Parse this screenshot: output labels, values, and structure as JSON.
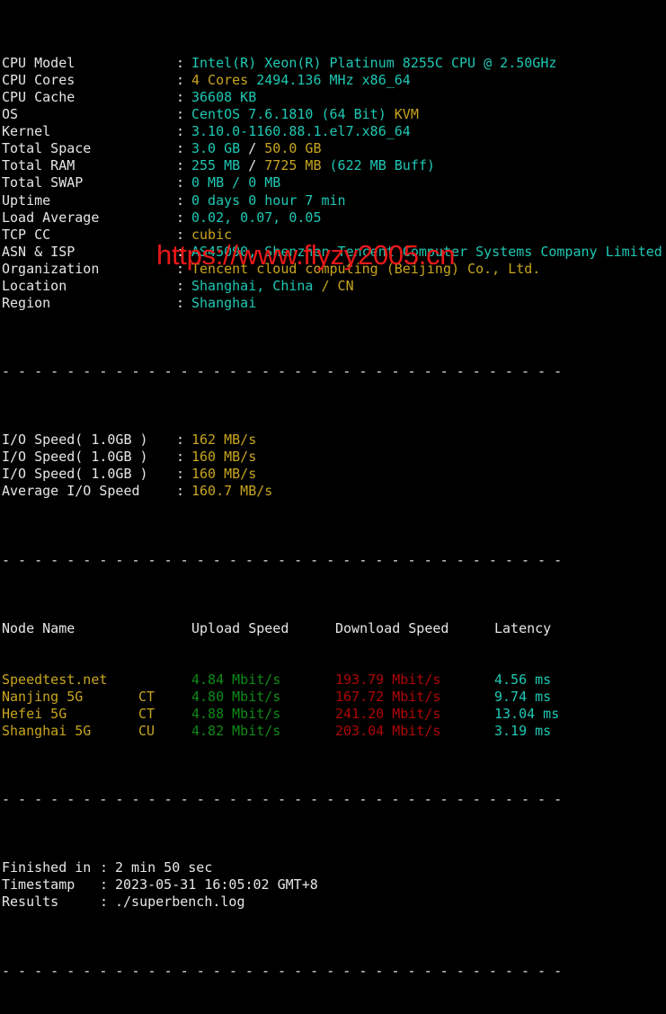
{
  "terminal": {
    "colon": ":",
    "separator_char": "-",
    "info_rows": [
      {
        "label": "CPU Model",
        "segments": [
          {
            "text": "Intel(R) Xeon(R) Platinum 8255C CPU @ 2.50GHz",
            "color": "cyan"
          }
        ]
      },
      {
        "label": "CPU Cores",
        "segments": [
          {
            "text": "4 Cores ",
            "color": "yellow"
          },
          {
            "text": "2494.136 MHz x86_64",
            "color": "cyan"
          }
        ]
      },
      {
        "label": "CPU Cache",
        "segments": [
          {
            "text": "36608 KB",
            "color": "cyan"
          }
        ]
      },
      {
        "label": "OS",
        "segments": [
          {
            "text": "CentOS 7.6.1810 (64 Bit) ",
            "color": "cyan"
          },
          {
            "text": "KVM",
            "color": "yellow"
          }
        ]
      },
      {
        "label": "Kernel",
        "segments": [
          {
            "text": "3.10.0-1160.88.1.el7.x86_64",
            "color": "cyan"
          }
        ]
      },
      {
        "label": "Total Space",
        "segments": [
          {
            "text": "3.0 GB ",
            "color": "cyan"
          },
          {
            "text": "/ ",
            "color": "white"
          },
          {
            "text": "50.0 GB",
            "color": "yellow"
          }
        ]
      },
      {
        "label": "Total RAM",
        "segments": [
          {
            "text": "255 MB ",
            "color": "cyan"
          },
          {
            "text": "/ ",
            "color": "white"
          },
          {
            "text": "7725 MB ",
            "color": "yellow"
          },
          {
            "text": "(622 MB Buff)",
            "color": "cyan"
          }
        ]
      },
      {
        "label": "Total SWAP",
        "segments": [
          {
            "text": "0 MB / 0 MB",
            "color": "cyan"
          }
        ]
      },
      {
        "label": "Uptime",
        "segments": [
          {
            "text": "0 days 0 hour 7 min",
            "color": "cyan"
          }
        ]
      },
      {
        "label": "Load Average",
        "segments": [
          {
            "text": "0.02, 0.07, 0.05",
            "color": "cyan"
          }
        ]
      },
      {
        "label": "TCP CC",
        "segments": [
          {
            "text": "cubic",
            "color": "yellow"
          }
        ]
      },
      {
        "label": "ASN & ISP",
        "segments": [
          {
            "text": "AS45090, Shenzhen Tencent Computer Systems Company Limited",
            "color": "cyan"
          }
        ]
      },
      {
        "label": "Organization",
        "segments": [
          {
            "text": "Tencent cloud computing (Beijing) Co., Ltd.",
            "color": "yellow"
          }
        ]
      },
      {
        "label": "Location",
        "segments": [
          {
            "text": "Shanghai, China ",
            "color": "cyan"
          },
          {
            "text": "/ CN",
            "color": "yellow"
          }
        ]
      },
      {
        "label": "Region",
        "segments": [
          {
            "text": "Shanghai",
            "color": "cyan"
          }
        ]
      }
    ],
    "io_rows": [
      {
        "label": "I/O Speed( 1.0GB )",
        "value": "162 MB/s"
      },
      {
        "label": "I/O Speed( 1.0GB )",
        "value": "160 MB/s"
      },
      {
        "label": "I/O Speed( 1.0GB )",
        "value": "160 MB/s"
      },
      {
        "label": "Average I/O Speed",
        "value": "160.7 MB/s"
      }
    ],
    "speedtest": {
      "headers": {
        "node": "Node Name",
        "isp": "",
        "upload": "Upload Speed",
        "download": "Download Speed",
        "latency": "Latency"
      },
      "rows": [
        {
          "node": "Speedtest.net",
          "isp": "",
          "upload": "4.84 Mbit/s",
          "download": "193.79 Mbit/s",
          "latency": "4.56 ms"
        },
        {
          "node": "Nanjing 5G",
          "isp": "CT",
          "upload": "4.80 Mbit/s",
          "download": "167.72 Mbit/s",
          "latency": "9.74 ms"
        },
        {
          "node": "Hefei 5G",
          "isp": "CT",
          "upload": "4.88 Mbit/s",
          "download": "241.20 Mbit/s",
          "latency": "13.04 ms"
        },
        {
          "node": "Shanghai 5G",
          "isp": "CU",
          "upload": "4.82 Mbit/s",
          "download": "203.04 Mbit/s",
          "latency": "3.19 ms"
        }
      ]
    },
    "footer_rows": [
      {
        "label": "Finished in",
        "value": "2 min 50 sec"
      },
      {
        "label": "Timestamp",
        "value": "2023-05-31 16:05:02 GMT+8"
      },
      {
        "label": "Results",
        "value": "./superbench.log"
      }
    ],
    "watermark": "https://www.flyzy2005.cn"
  },
  "colors": {
    "background": "#000000",
    "foreground": "#e6e6e6",
    "cyan": "#1ec8b4",
    "yellow": "#c8a520",
    "green": "#0f8a17",
    "red": "#b00606",
    "watermark": "#e81818"
  }
}
